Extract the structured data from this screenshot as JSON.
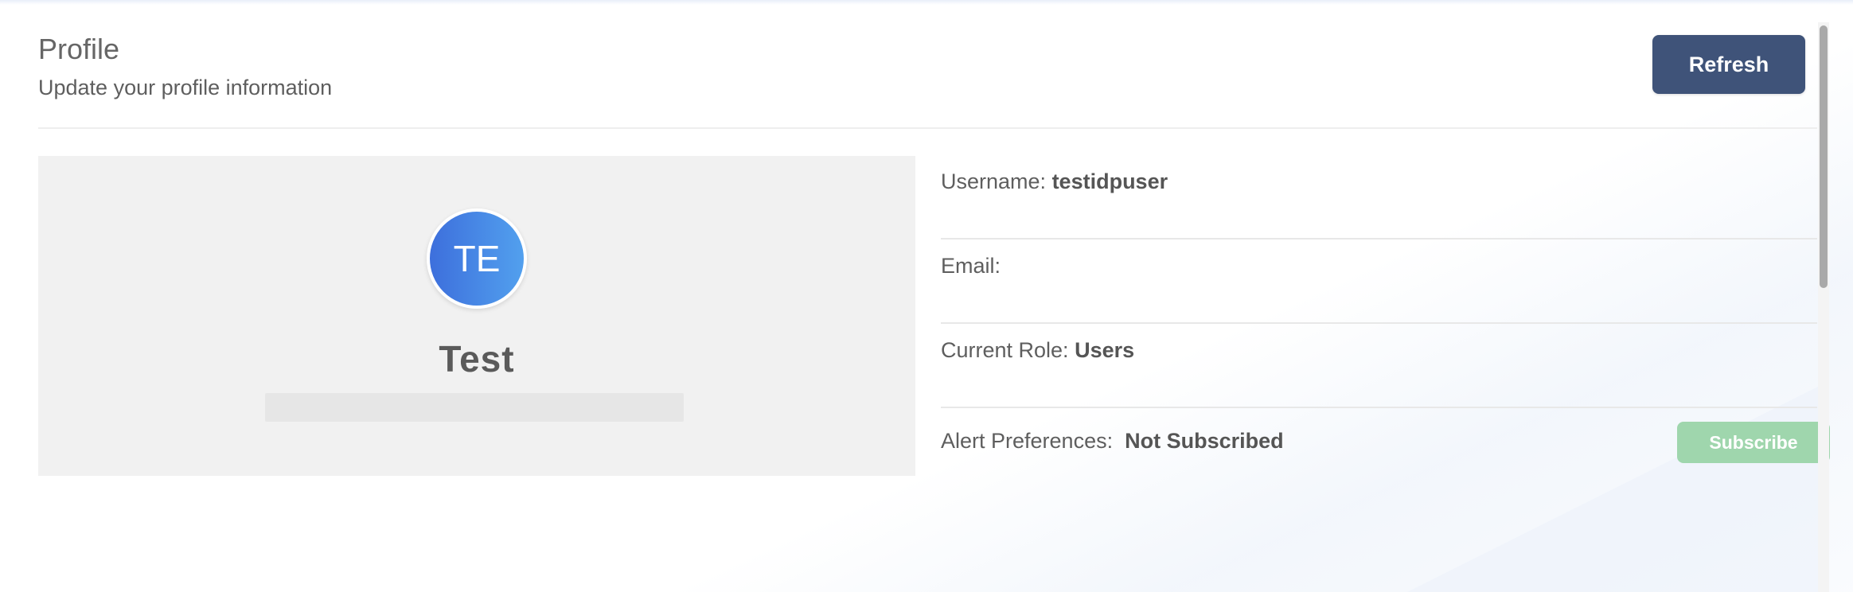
{
  "header": {
    "title": "Profile",
    "subtitle": "Update your profile information",
    "refresh_label": "Refresh"
  },
  "profile_card": {
    "avatar_initials": "TE",
    "display_name": "Test"
  },
  "details": {
    "username_label": "Username:",
    "username_value": "testidpuser",
    "email_label": "Email:",
    "email_value": "",
    "role_label": "Current Role:",
    "role_value": "Users",
    "alerts_label": "Alert Preferences:",
    "alerts_value": "Not Subscribed",
    "subscribe_label": "Subscribe"
  },
  "colors": {
    "primary_button": "#3f5379",
    "subscribe_button": "#9fd6ad",
    "avatar_gradient_start": "#3d6fdc",
    "avatar_gradient_end": "#52a0ee"
  }
}
